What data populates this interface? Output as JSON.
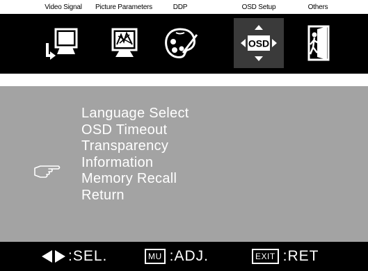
{
  "tabs": [
    {
      "label": "Video Signal",
      "icon": "video-signal-icon"
    },
    {
      "label": "Picture Parameters",
      "icon": "picture-parameters-icon"
    },
    {
      "label": "DDP",
      "icon": "palette-icon"
    },
    {
      "label": "OSD Setup",
      "icon": "osd-icon",
      "selected": true,
      "icon_text": "OSD"
    },
    {
      "label": "Others",
      "icon": "exit-door-icon"
    }
  ],
  "menu": {
    "items": [
      {
        "label": "Language Select"
      },
      {
        "label": "OSD Timeout"
      },
      {
        "label": "Transparency"
      },
      {
        "label": "Information",
        "selected": true
      },
      {
        "label": "Memory Recall"
      },
      {
        "label": "Return"
      }
    ],
    "pointer_icon": "hand-pointer-icon"
  },
  "hints": {
    "select_label": ":SEL.",
    "adjust_key": "MU",
    "adjust_label": ":ADJ.",
    "exit_key": "EXIT",
    "exit_label": ":RET"
  },
  "colors": {
    "bar_background": "#000000",
    "panel_background": "#a3a3a3",
    "menu_text": "#ffffff",
    "selected_tab_background": "#3a3a3a"
  }
}
